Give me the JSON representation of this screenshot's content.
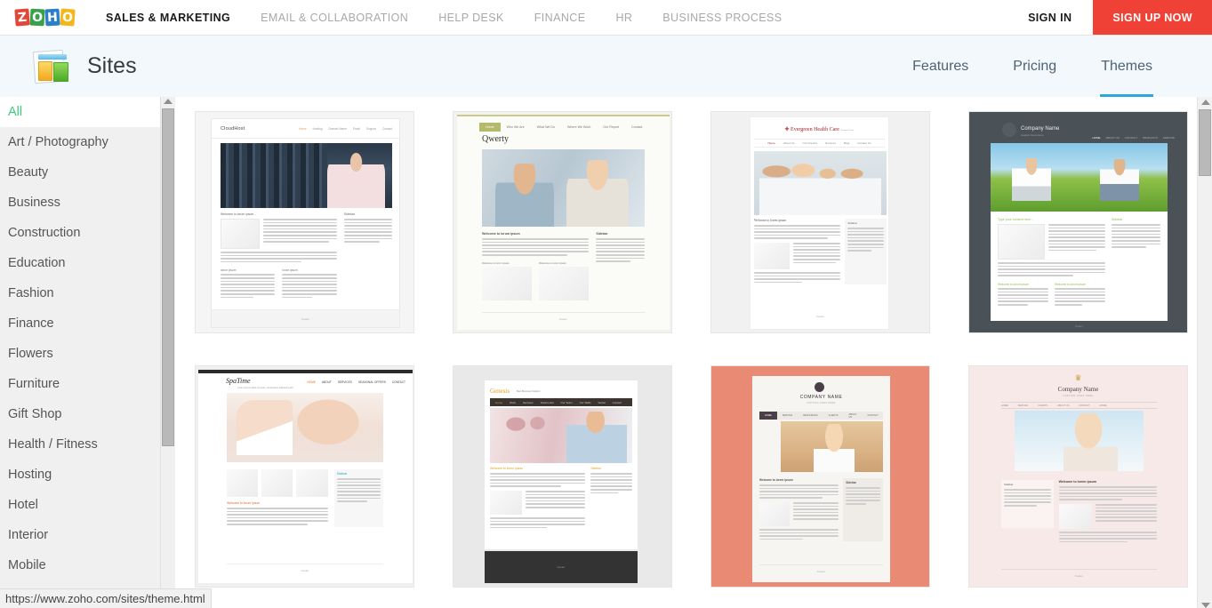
{
  "topnav": {
    "logo_letters": [
      "Z",
      "O",
      "H",
      "O"
    ],
    "items": [
      {
        "label": "SALES & MARKETING",
        "active": true
      },
      {
        "label": "EMAIL & COLLABORATION",
        "active": false
      },
      {
        "label": "HELP DESK",
        "active": false
      },
      {
        "label": "FINANCE",
        "active": false
      },
      {
        "label": "HR",
        "active": false
      },
      {
        "label": "BUSINESS PROCESS",
        "active": false
      }
    ],
    "sign_in": "SIGN IN",
    "sign_up": "SIGN UP NOW",
    "signup_color": "#ef4136"
  },
  "product_header": {
    "title": "Sites",
    "icon": "sites-icon",
    "nav": [
      {
        "label": "Features",
        "active": false
      },
      {
        "label": "Pricing",
        "active": false
      },
      {
        "label": "Themes",
        "active": true
      }
    ],
    "active_color": "#2aa8d8",
    "background": "#f2f8fc"
  },
  "sidebar": {
    "active_color": "#3ecb7e",
    "items": [
      {
        "label": "All",
        "active": true
      },
      {
        "label": "Art / Photography",
        "active": false
      },
      {
        "label": "Beauty",
        "active": false
      },
      {
        "label": "Business",
        "active": false
      },
      {
        "label": "Construction",
        "active": false
      },
      {
        "label": "Education",
        "active": false
      },
      {
        "label": "Fashion",
        "active": false
      },
      {
        "label": "Finance",
        "active": false
      },
      {
        "label": "Flowers",
        "active": false
      },
      {
        "label": "Furniture",
        "active": false
      },
      {
        "label": "Gift Shop",
        "active": false
      },
      {
        "label": "Health / Fitness",
        "active": false
      },
      {
        "label": "Hosting",
        "active": false
      },
      {
        "label": "Hotel",
        "active": false
      },
      {
        "label": "Interior",
        "active": false
      },
      {
        "label": "Mobile",
        "active": false
      }
    ]
  },
  "themes": [
    {
      "name": "CloudHost",
      "logo": "CloudHost",
      "nav": [
        "Home",
        "Hosting",
        "Domain Name",
        "Email",
        "Support",
        "Contact"
      ],
      "accent": "#f09a64",
      "background": "#f5f5f5",
      "welcome_heading": "Welcome to lorum ipsum...",
      "sidebar_heading": "Sidebar",
      "sub_headings": [
        "lorum ipsum",
        "lorum ipsum"
      ],
      "footer": "Footer",
      "photo": "p-server"
    },
    {
      "name": "Qwerty",
      "logo": "Qwerty",
      "nav": [
        "Home",
        "Who We Are",
        "What We Do",
        "Where We Work",
        "Our Report",
        "Contact"
      ],
      "accent": "#b5b96a",
      "background": "#f2f2ef",
      "welcome_heading": "Welcome to lorum ipsum",
      "sidebar_heading": "Sidebar",
      "sub_headings": [
        "Welcome to lorum ipsum",
        "Welcome to lorum ipsum"
      ],
      "footer": "Footer",
      "photo": "p-couple"
    },
    {
      "name": "Evergreen Health Care",
      "logo": "Evergreen Health Care",
      "logo_sub": "Hospital Center",
      "nav": [
        "Home",
        "About Us",
        "Our Doctors",
        "Services",
        "Blog",
        "Contact Us"
      ],
      "accent": "#9f1d22",
      "background": "#f1f1f1",
      "welcome_heading": "Welcome to lorem ipsum",
      "sidebar_heading": "Sidebar",
      "footer": "Footer",
      "photo": "p-doctors"
    },
    {
      "name": "Company Name",
      "logo": "Company Name",
      "logo_sub": "Caption Goes Here",
      "nav": [
        "HOME",
        "ABOUT US",
        "CONTACT",
        "PRODUCTS",
        "SERVICE"
      ],
      "accent": "#8bc34a",
      "background": "#4a5257",
      "welcome_heading": "Type your content here...",
      "sidebar_heading": "Sidebar",
      "sub_headings": [
        "Welcome to lorum ipsum",
        "Welcome to lorum ipsum"
      ],
      "footer": "Footer",
      "photo": "p-field"
    },
    {
      "name": "SpaTime",
      "logo": "SpaTime",
      "logo_sub": "Lorem ipsum dolor sit amet, consectetur adipiscing elit",
      "nav": [
        "HOME",
        "ABOUT",
        "SERVICES",
        "SEASONAL OFFERS",
        "CONTACT"
      ],
      "accent": "#f26522",
      "background": "#f0f0f0",
      "welcome_heading": "Welcome to lorum ipsum",
      "sidebar_heading": "Sidebar",
      "footer": "Footer",
      "photo": "p-spa"
    },
    {
      "name": "Genesis",
      "logo": "Genesis",
      "logo_sub": "Best Business Solution",
      "nav": [
        "Home",
        "Work",
        "Services",
        "Testimonial",
        "Our Team",
        "Our Skills",
        "Social",
        "Contact"
      ],
      "accent": "#e0a022",
      "background": "#e9e9e9",
      "welcome_heading": "Welcome to lorem ipsum",
      "sidebar_heading": "Sidebar",
      "footer": "Footer",
      "photo": "p-office"
    },
    {
      "name": "COMPANY NAME",
      "logo": "COMPANY NAME",
      "logo_sub": "CAPTION GOES HERE",
      "nav": [
        "HOME",
        "SERVICE",
        "RESOURCES",
        "CLIENTS",
        "ABOUT US",
        "CONTACT"
      ],
      "accent": "#e98a75",
      "background": "#e98a75",
      "welcome_heading": "Welcome to lorem ipsum",
      "sidebar_heading": "Sidebar",
      "footer": "Footer",
      "photo": "p-woman"
    },
    {
      "name": "Company Name",
      "logo": "Company Name",
      "logo_sub": "CAPTION GOES HERE",
      "nav": [
        "HOME",
        "SERVICE",
        "CLIENTS",
        "ABOUT US",
        "CONTACT",
        "MORE"
      ],
      "accent": "#caa148",
      "background": "#f6e9e7",
      "welcome_heading": "Welcome to lorem ipsum",
      "sidebar_heading": "Sidebar",
      "footer": "Footer",
      "photo": "p-glasses"
    }
  ],
  "status_bar": {
    "url": "https://www.zoho.com/sites/theme.html"
  }
}
